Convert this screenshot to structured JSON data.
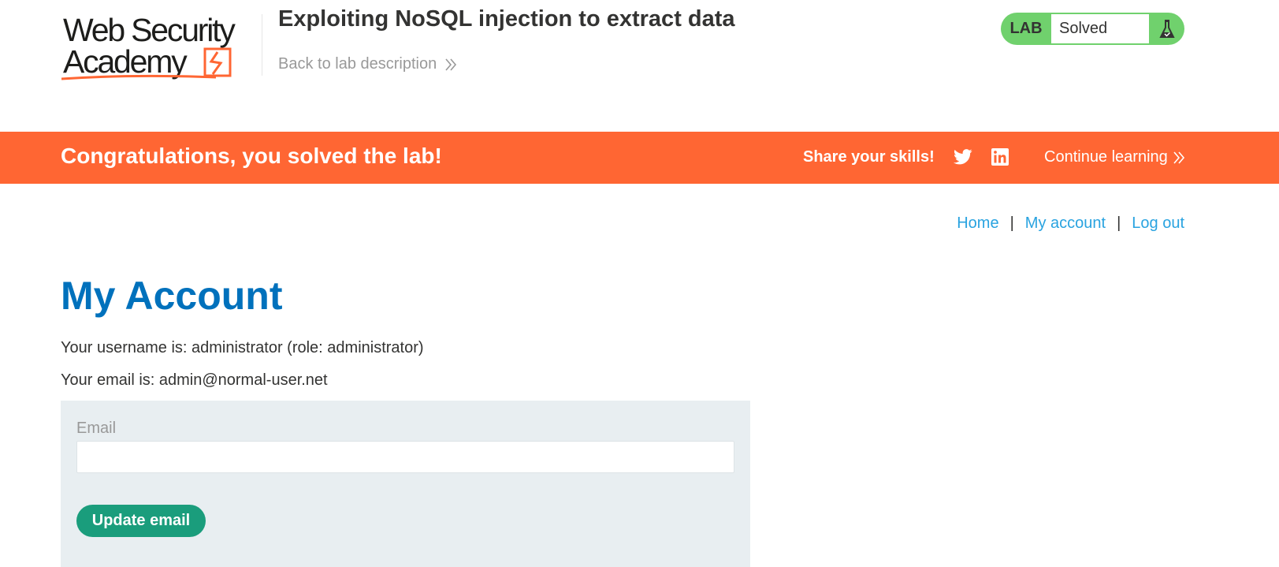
{
  "header": {
    "logo_text_line1": "Web Security",
    "logo_text_line2": "Academy",
    "lab_title": "Exploiting NoSQL injection to extract data",
    "back_link": "Back to lab description",
    "lab_status": {
      "label": "LAB",
      "value": "Solved",
      "icon": "flask-icon"
    }
  },
  "banner": {
    "message": "Congratulations, you solved the lab!",
    "share_text": "Share your skills!",
    "social_icons": [
      "twitter-icon",
      "linkedin-icon"
    ],
    "continue_link": "Continue learning"
  },
  "nav": {
    "home": "Home",
    "separator": "|",
    "my_account": "My account",
    "log_out": "Log out"
  },
  "account": {
    "heading": "My Account",
    "username_line": "Your username is: administrator (role: administrator)",
    "email_line": "Your email is: admin@normal-user.net"
  },
  "form": {
    "email_label": "Email",
    "email_value": "",
    "submit_label": "Update email"
  },
  "colors": {
    "banner": "#ff6633",
    "lab_status_green": "#70d16d",
    "heading_blue": "#0071bc",
    "link_blue": "#29a3e0",
    "button_green": "#1a9d7c",
    "form_bg": "#e8eef1"
  }
}
